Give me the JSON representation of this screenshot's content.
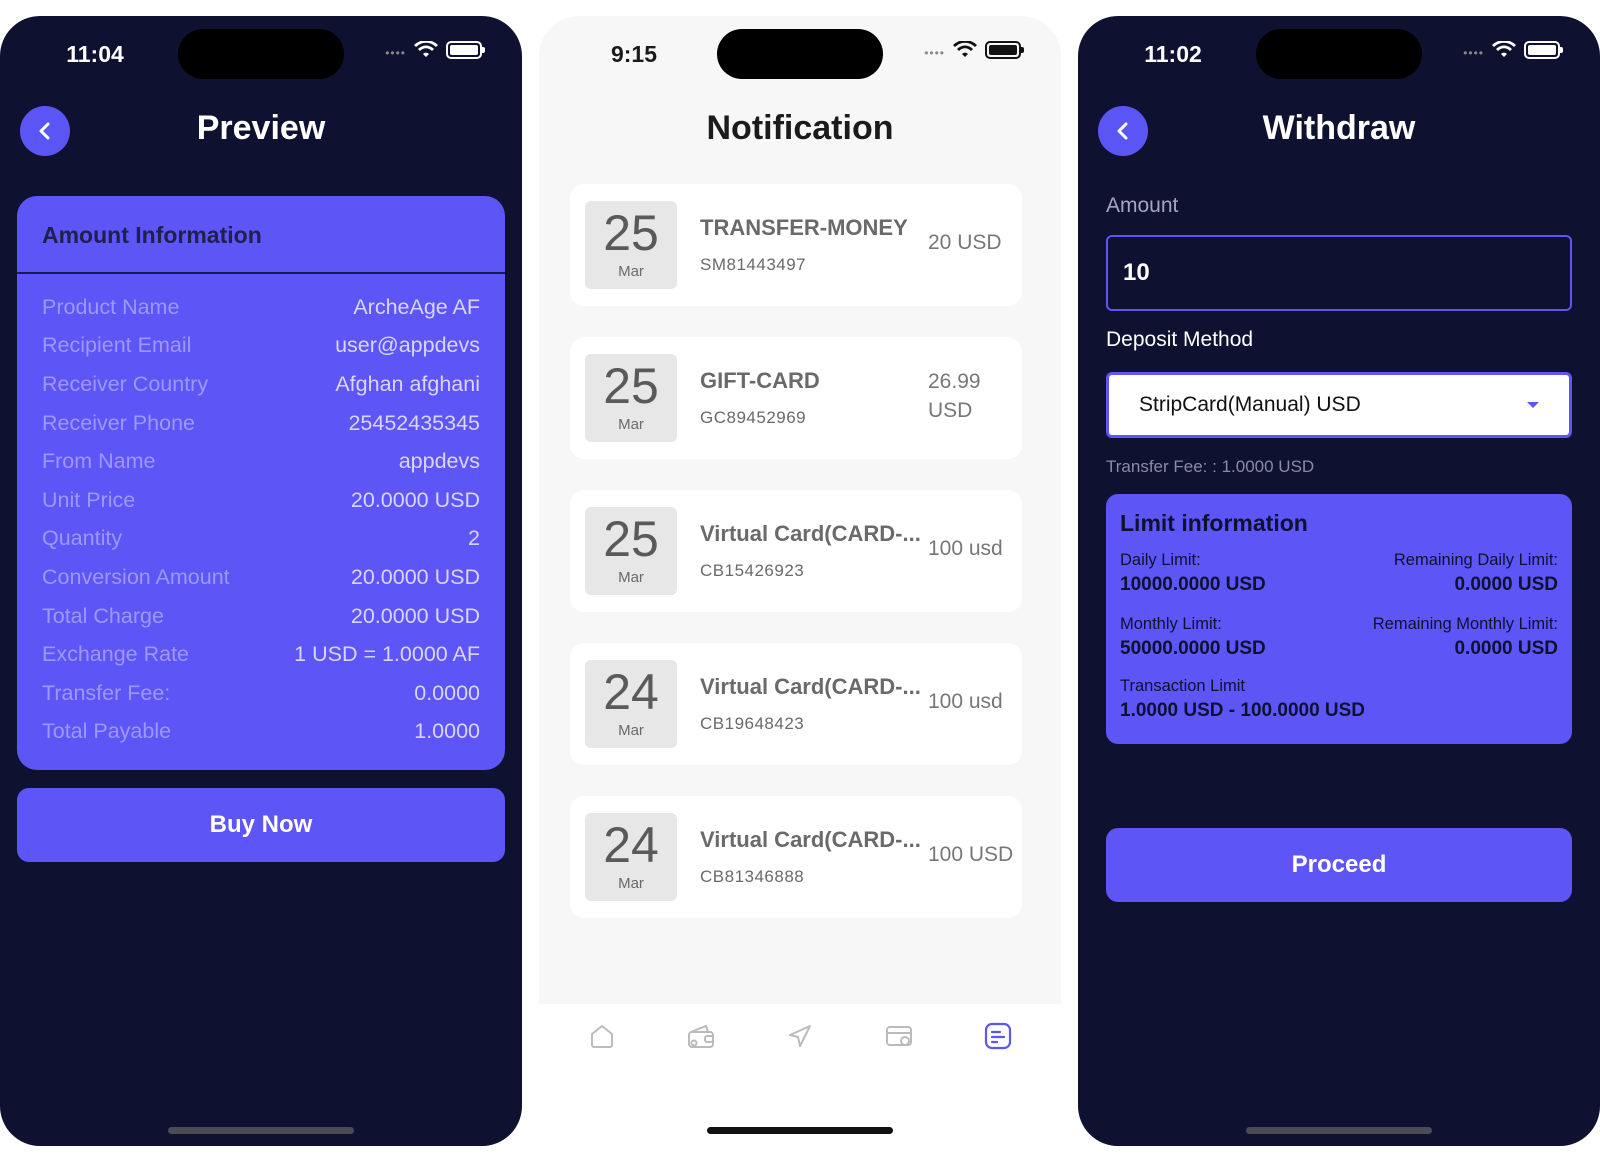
{
  "colors": {
    "background_dark": "#0f1131",
    "accent": "#5e55f6",
    "light_bg": "#f7f7f7"
  },
  "preview": {
    "status_time": "11:04",
    "title": "Preview",
    "card_title": "Amount Information",
    "rows": [
      {
        "label": "Product Name",
        "value": "ArcheAge AF"
      },
      {
        "label": "Recipient Email",
        "value": "user@appdevs"
      },
      {
        "label": "Receiver Country",
        "value": "Afghan afghani"
      },
      {
        "label": "Receiver Phone",
        "value": "25452435345"
      },
      {
        "label": "From Name",
        "value": "appdevs"
      },
      {
        "label": "Unit Price",
        "value": "20.0000 USD"
      },
      {
        "label": "Quantity",
        "value": "2"
      },
      {
        "label": "Conversion Amount",
        "value": "20.0000 USD"
      },
      {
        "label": "Total Charge",
        "value": "20.0000 USD"
      },
      {
        "label": "Exchange Rate",
        "value": "1 USD = 1.0000 AF"
      },
      {
        "label": "Transfer Fee:",
        "value": "0.0000"
      },
      {
        "label": "Total Payable",
        "value": "1.0000"
      }
    ],
    "button": "Buy Now"
  },
  "notification": {
    "status_time": "9:15",
    "title": "Notification",
    "items": [
      {
        "day": "25",
        "month": "Mar",
        "title": "TRANSFER-MONEY",
        "code": "SM81443497",
        "amount": "20 USD"
      },
      {
        "day": "25",
        "month": "Mar",
        "title": "GIFT-CARD",
        "code": "GC89452969",
        "amount": "26.99 USD"
      },
      {
        "day": "25",
        "month": "Mar",
        "title": "Virtual Card(CARD-...",
        "code": "CB15426923",
        "amount": "100 usd"
      },
      {
        "day": "24",
        "month": "Mar",
        "title": "Virtual Card(CARD-...",
        "code": "CB19648423",
        "amount": "100 usd"
      },
      {
        "day": "24",
        "month": "Mar",
        "title": "Virtual Card(CARD-...",
        "code": "CB81346888",
        "amount": "100 USD"
      }
    ],
    "tabs": [
      "home-icon",
      "wallet-icon",
      "send-icon",
      "card-icon",
      "notification-icon"
    ]
  },
  "withdraw": {
    "status_time": "11:02",
    "title": "Withdraw",
    "amount_label": "Amount",
    "amount_value": "10",
    "method_label": "Deposit Method",
    "method_value": "StripCard(Manual) USD",
    "fee_text": "Transfer Fee: : 1.0000 USD",
    "limit_title": "Limit information",
    "daily_limit_label": "Daily Limit:",
    "daily_limit_value": "10000.0000 USD",
    "remaining_daily_label": "Remaining Daily Limit:",
    "remaining_daily_value": "0.0000 USD",
    "monthly_limit_label": "Monthly Limit:",
    "monthly_limit_value": "50000.0000 USD",
    "remaining_monthly_label": "Remaining Monthly Limit:",
    "remaining_monthly_value": "0.0000 USD",
    "transaction_limit_label": "Transaction Limit",
    "transaction_limit_value": "1.0000 USD - 100.0000 USD",
    "button": "Proceed"
  }
}
